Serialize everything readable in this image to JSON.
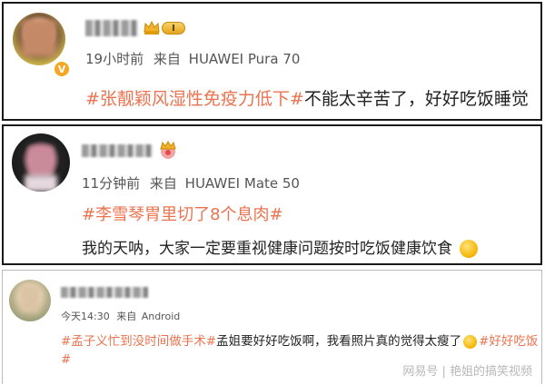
{
  "posts": [
    {
      "time": "19小时前",
      "from_label": "来自",
      "device": "HUAWEI Pura 70",
      "tag": "#张靓颖风湿性免疫力低下#",
      "text": "不能太辛苦了，好好吃饭睡觉",
      "level_badge": "I"
    },
    {
      "time": "11分钟前",
      "from_label": "来自",
      "device": "HUAWEI Mate 50",
      "tag": "#李雪琴胃里切了8个息肉#",
      "text": "我的天呐，大家一定要重视健康问题按时吃饭健康饮食"
    },
    {
      "time": "今天14:30",
      "from_label": "来自",
      "device": "Android",
      "tag": "#孟子义忙到没时间做手术#",
      "text": "孟姐要好好吃饭啊，我看照片真的觉得太瘦了",
      "tag2": "#好好吃饭",
      "tag2_cont": "#"
    }
  ],
  "watermark": "网易号 | 艳姐的搞笑视频",
  "colors": {
    "tag": "#eb7350",
    "border": "#1a1a1a",
    "verified_badge": "#f5a623"
  },
  "icons": [
    "verified-v-icon",
    "vip-crown-icon",
    "level-badge-icon",
    "smile-emoji-icon",
    "sweat-emoji-icon"
  ]
}
